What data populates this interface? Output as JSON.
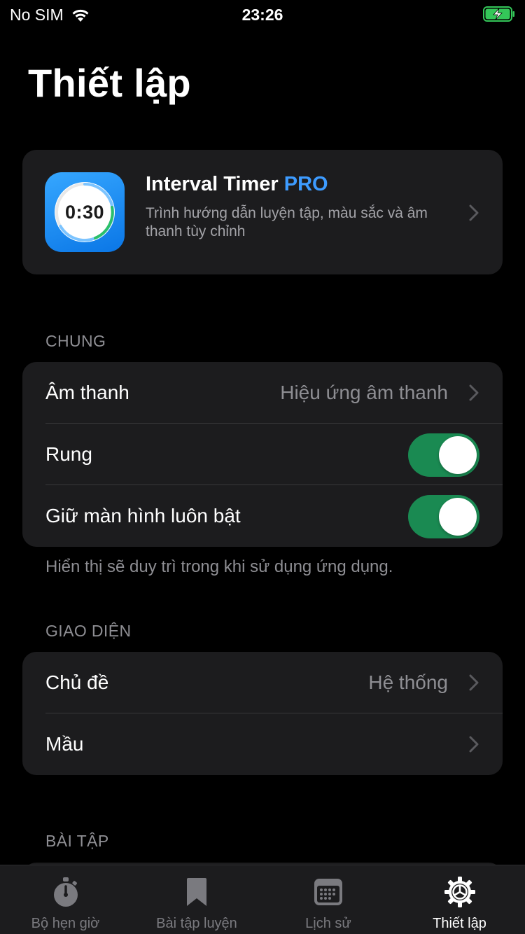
{
  "status_bar": {
    "carrier": "No SIM",
    "time": "23:26"
  },
  "page_title": "Thiết lập",
  "promo": {
    "app_name": "Interval Timer",
    "badge": "PRO",
    "description": "Trình hướng dẫn luyện tập, màu sắc và âm thanh tùy chỉnh",
    "icon_time": "0:30"
  },
  "general": {
    "header": "CHUNG",
    "sound": {
      "label": "Âm thanh",
      "value": "Hiệu ứng âm thanh"
    },
    "vibrate": {
      "label": "Rung",
      "on": true
    },
    "keep_screen_on": {
      "label": "Giữ màn hình luôn bật",
      "on": true
    },
    "footnote": "Hiển thị sẽ duy trì trong khi sử dụng ứng dụng."
  },
  "appearance": {
    "header": "GIAO DIỆN",
    "theme": {
      "label": "Chủ đề",
      "value": "Hệ thống"
    },
    "color": {
      "label": "Mầu"
    }
  },
  "workouts": {
    "header": "BÀI TẬP"
  },
  "tabs": [
    {
      "label": "Bộ hẹn giờ",
      "icon": "stopwatch-icon",
      "active": false
    },
    {
      "label": "Bài tập luyện",
      "icon": "bookmark-icon",
      "active": false
    },
    {
      "label": "Lịch sử",
      "icon": "calendar-icon",
      "active": false
    },
    {
      "label": "Thiết lập",
      "icon": "gear-icon",
      "active": true
    }
  ],
  "colors": {
    "accent": "#3d9bff",
    "toggle_on": "#1a8a52",
    "battery": "#34c759"
  }
}
